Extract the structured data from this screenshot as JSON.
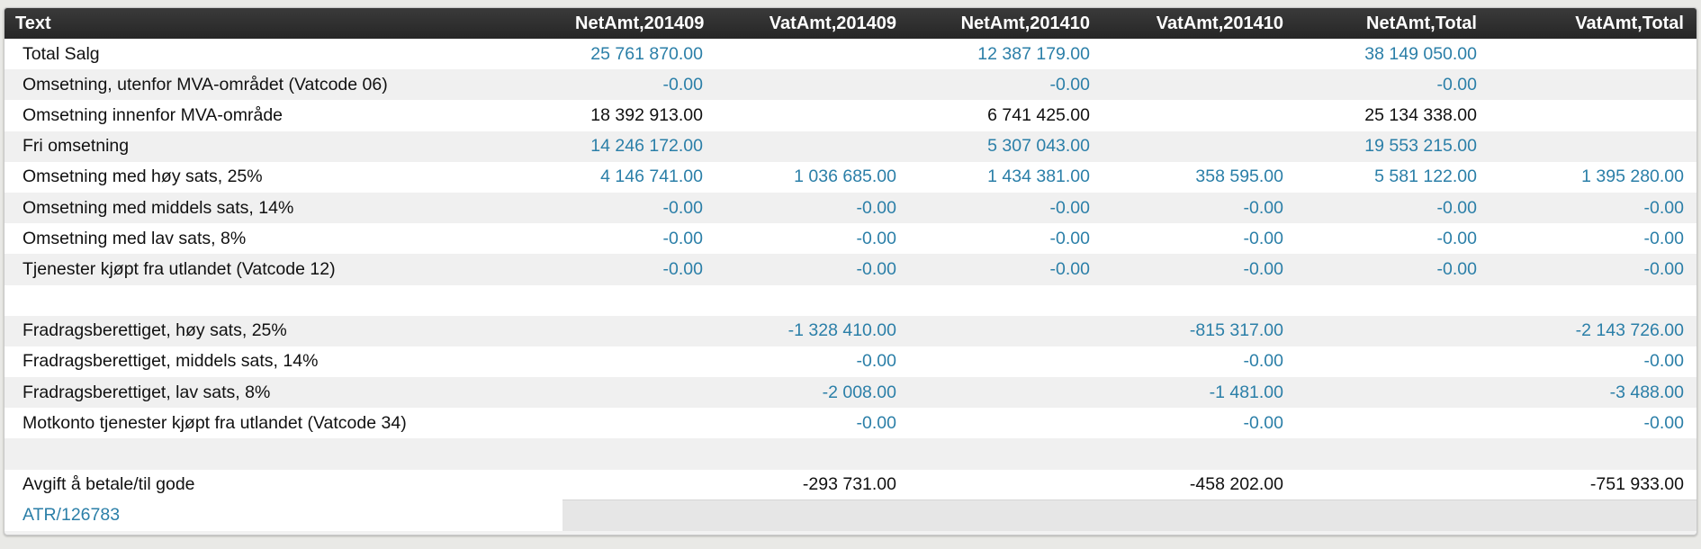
{
  "columns": [
    "Text",
    "NetAmt,201409",
    "VatAmt,201409",
    "NetAmt,201410",
    "VatAmt,201410",
    "NetAmt,Total",
    "VatAmt,Total"
  ],
  "rows": [
    {
      "text": "Total Salg",
      "values": [
        "25 761 870.00",
        "",
        "12 387 179.00",
        "",
        "38 149 050.00",
        ""
      ],
      "dark": false
    },
    {
      "text": "Omsetning, utenfor MVA-området (Vatcode 06)",
      "values": [
        "-0.00",
        "",
        "-0.00",
        "",
        "-0.00",
        ""
      ],
      "dark": false
    },
    {
      "text": "Omsetning innenfor MVA-område",
      "values": [
        "18 392 913.00",
        "",
        "6 741 425.00",
        "",
        "25 134 338.00",
        ""
      ],
      "dark": true
    },
    {
      "text": "Fri omsetning",
      "values": [
        "14 246 172.00",
        "",
        "5 307 043.00",
        "",
        "19 553 215.00",
        ""
      ],
      "dark": false
    },
    {
      "text": "Omsetning med høy sats, 25%",
      "values": [
        "4 146 741.00",
        "1 036 685.00",
        "1 434 381.00",
        "358 595.00",
        "5 581 122.00",
        "1 395 280.00"
      ],
      "dark": false
    },
    {
      "text": "Omsetning med middels sats, 14%",
      "values": [
        "-0.00",
        "-0.00",
        "-0.00",
        "-0.00",
        "-0.00",
        "-0.00"
      ],
      "dark": false
    },
    {
      "text": "Omsetning med lav sats, 8%",
      "values": [
        "-0.00",
        "-0.00",
        "-0.00",
        "-0.00",
        "-0.00",
        "-0.00"
      ],
      "dark": false
    },
    {
      "text": "Tjenester kjøpt fra utlandet (Vatcode 12)",
      "values": [
        "-0.00",
        "-0.00",
        "-0.00",
        "-0.00",
        "-0.00",
        "-0.00"
      ],
      "dark": false
    },
    {
      "text": "",
      "values": [
        "",
        "",
        "",
        "",
        "",
        ""
      ],
      "dark": false
    },
    {
      "text": "Fradragsberettiget, høy sats, 25%",
      "values": [
        "",
        "-1 328 410.00",
        "",
        "-815 317.00",
        "",
        "-2 143 726.00"
      ],
      "dark": false
    },
    {
      "text": "Fradragsberettiget, middels sats, 14%",
      "values": [
        "",
        "-0.00",
        "",
        "-0.00",
        "",
        "-0.00"
      ],
      "dark": false
    },
    {
      "text": "Fradragsberettiget, lav sats, 8%",
      "values": [
        "",
        "-2 008.00",
        "",
        "-1 481.00",
        "",
        "-3 488.00"
      ],
      "dark": false
    },
    {
      "text": "Motkonto tjenester kjøpt fra utlandet (Vatcode 34)",
      "values": [
        "",
        "-0.00",
        "",
        "-0.00",
        "",
        "-0.00"
      ],
      "dark": false
    },
    {
      "text": "",
      "values": [
        "",
        "",
        "",
        "",
        "",
        ""
      ],
      "dark": false
    },
    {
      "text": "Avgift å betale/til gode",
      "values": [
        "",
        "-293 731.00",
        "",
        "-458 202.00",
        "",
        "-751 933.00"
      ],
      "dark": true
    }
  ],
  "footer_link": "ATR/126783",
  "colors": {
    "header_bg": "#2e2e2e",
    "link": "#2b7fa8",
    "row_alt": "#f0f0f0"
  }
}
